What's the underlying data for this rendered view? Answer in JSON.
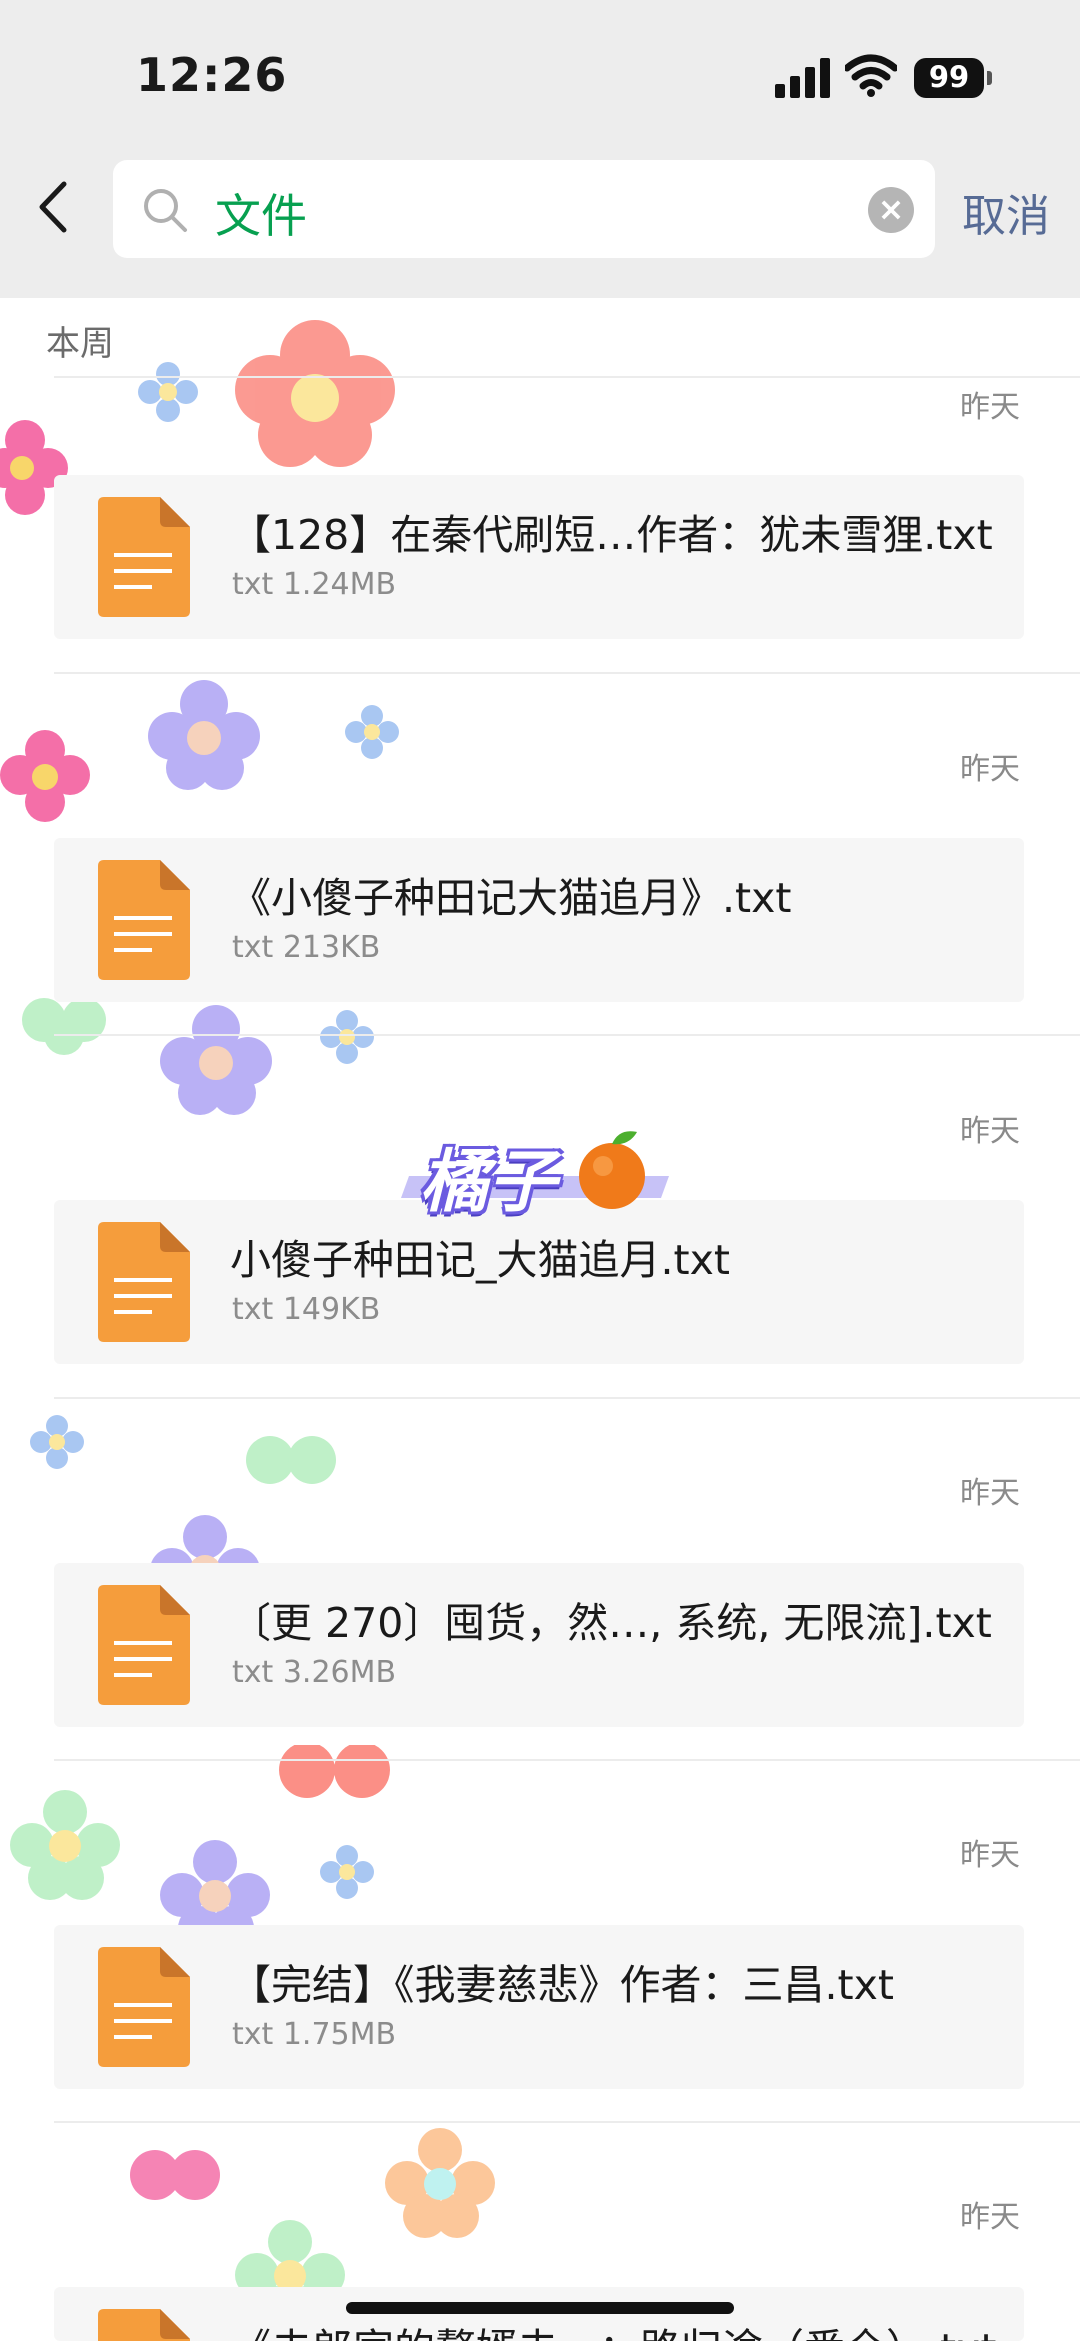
{
  "status_bar": {
    "time": "12:26",
    "battery": "99"
  },
  "search": {
    "value": "文件",
    "cancel_label": "取消"
  },
  "section_title": "本周",
  "files": [
    {
      "date": "昨天",
      "name": "【128】在秦代刷短…作者：犹未雪狸.txt",
      "meta": "txt 1.24MB"
    },
    {
      "date": "昨天",
      "name": "《小傻子种田记大猫追月》.txt",
      "meta": "txt 213KB"
    },
    {
      "date": "昨天",
      "name": "小傻子种田记_大猫追月.txt",
      "meta": "txt 149KB"
    },
    {
      "date": "昨天",
      "name": "〔更 270〕囤货，然…, 系统, 无限流].txt",
      "meta": "txt 3.26MB"
    },
    {
      "date": "昨天",
      "name": "【完结】《我妻慈悲》作者：三昌.txt",
      "meta": "txt 1.75MB"
    },
    {
      "date": "昨天",
      "name": "《夫郎家的赘婿夫…：路归途（番全）.txt",
      "meta": ""
    }
  ],
  "watermark": {
    "text": "橘子"
  },
  "icons": {
    "back": "chevron-left-icon",
    "search": "search-icon",
    "clear": "clear-icon",
    "file": "document-icon",
    "orange": "orange-icon"
  },
  "colors": {
    "accent_green": "#07a050",
    "link_blue": "#576b95",
    "file_icon_orange": "#f59d3c",
    "topbar_bg": "#ededed"
  }
}
